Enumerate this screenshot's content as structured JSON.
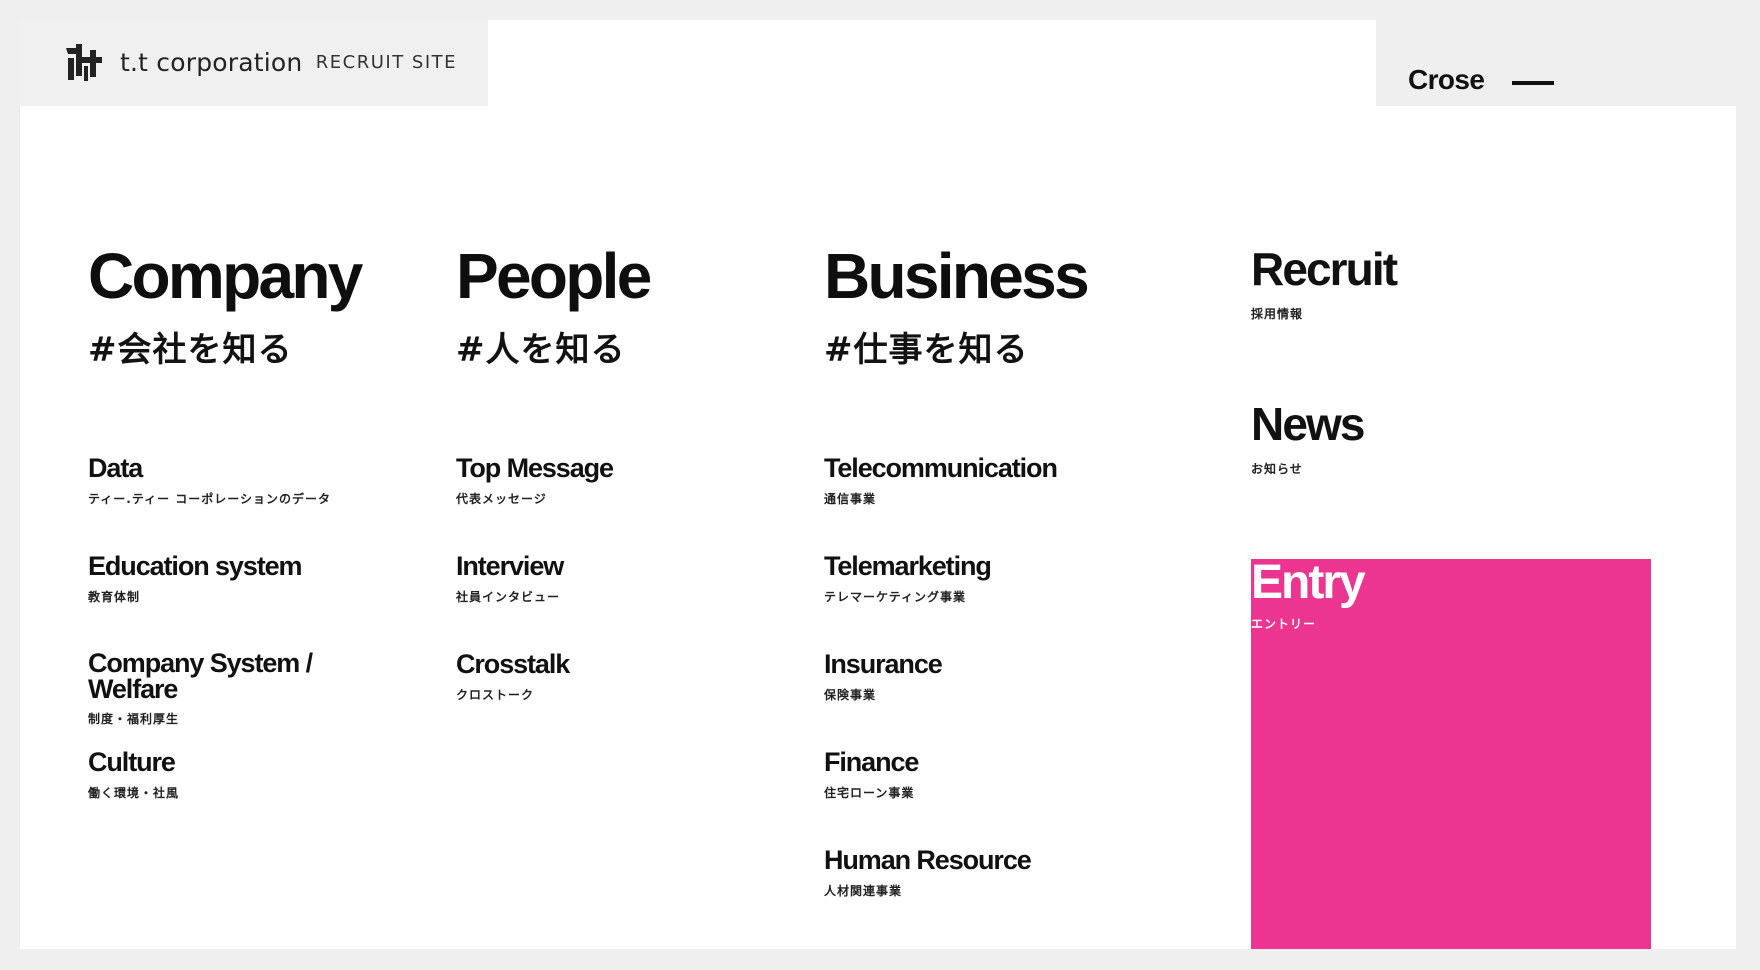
{
  "header": {
    "brand": "t.t corporation",
    "site_label": "RECRUIT SITE",
    "close_label": "Crose"
  },
  "menu": {
    "company": {
      "title": "Company",
      "subtitle": "#会社を知る",
      "items": [
        {
          "label": "Data",
          "sub": "ティー.ティー コーポレーションのデータ"
        },
        {
          "label": "Education system",
          "sub": "教育体制"
        },
        {
          "label": "Company System / Welfare",
          "sub": "制度・福利厚生"
        },
        {
          "label": "Culture",
          "sub": "働く環境・社風"
        }
      ]
    },
    "people": {
      "title": "People",
      "subtitle": "#人を知る",
      "items": [
        {
          "label": "Top Message",
          "sub": "代表メッセージ"
        },
        {
          "label": "Interview",
          "sub": "社員インタビュー"
        },
        {
          "label": "Crosstalk",
          "sub": "クロストーク"
        }
      ]
    },
    "business": {
      "title": "Business",
      "subtitle": "#仕事を知る",
      "items": [
        {
          "label": "Telecommunication",
          "sub": "通信事業"
        },
        {
          "label": "Telemarketing",
          "sub": "テレマーケティング事業"
        },
        {
          "label": "Insurance",
          "sub": "保険事業"
        },
        {
          "label": "Finance",
          "sub": "住宅ローン事業"
        },
        {
          "label": "Human Resource",
          "sub": "人材関連事業"
        }
      ]
    },
    "side": {
      "recruit": {
        "label": "Recruit",
        "sub": "採用情報"
      },
      "news": {
        "label": "News",
        "sub": "お知らせ"
      },
      "entry": {
        "label": "Entry",
        "sub": "エントリー"
      }
    }
  },
  "colors": {
    "accent": "#ec3590",
    "text": "#111111",
    "background": "#efefef",
    "panel": "#ffffff"
  },
  "icons": {
    "logo": "tt-corporation-logo-icon",
    "close": "close-line-icon"
  }
}
